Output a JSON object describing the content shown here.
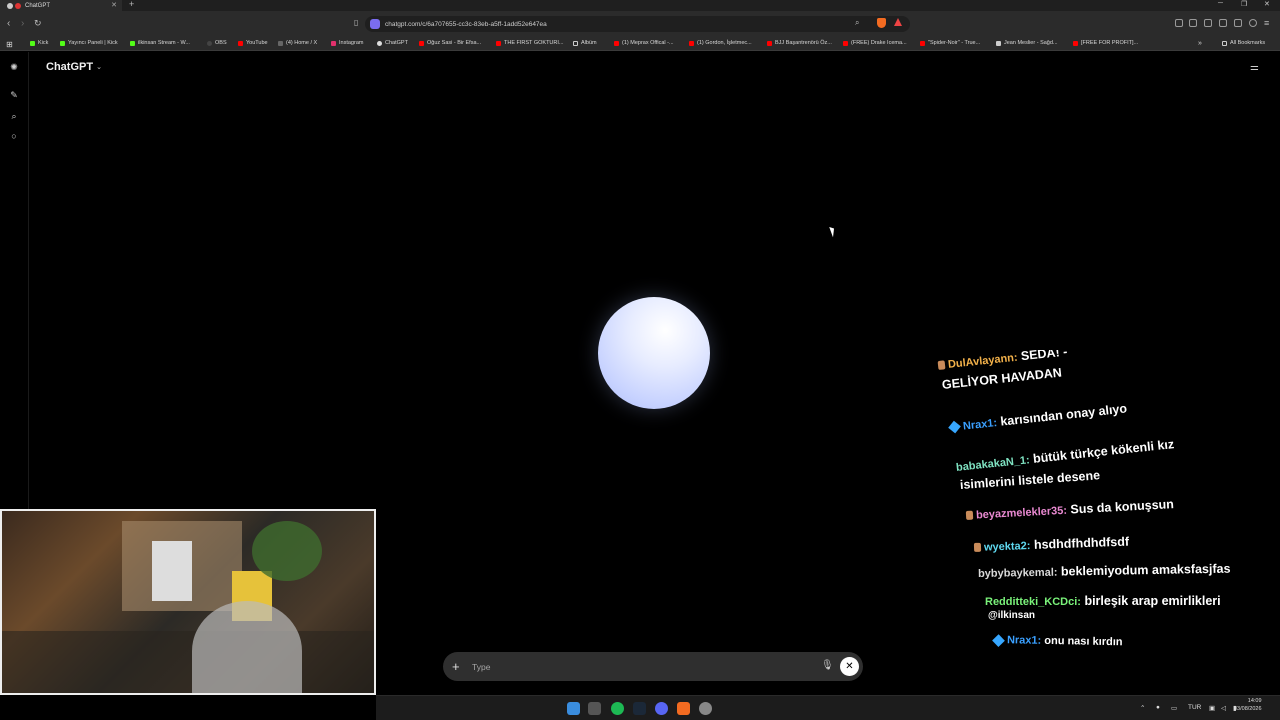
{
  "browser": {
    "tab_title": "ChatGPT",
    "url": "chatgpt.com/c/6a707655-cc3c-83eb-a5ff-1add52e647ea",
    "bookmarks": [
      {
        "label": "Kick",
        "color": "#53fc18"
      },
      {
        "label": "Yayıncı Paneli | Kick",
        "color": "#53fc18"
      },
      {
        "label": "ilkinsan Stream - W...",
        "color": "#53fc18"
      },
      {
        "label": "OBS",
        "color": "#333333"
      },
      {
        "label": "YouTube",
        "color": "#ff0000"
      },
      {
        "label": "(4) Home / X",
        "color": "#111111"
      },
      {
        "label": "Instagram",
        "color": "#e1306c"
      },
      {
        "label": "ChatGPT",
        "color": "#dddddd"
      },
      {
        "label": "Oğuz Sasi - Bir Efsa...",
        "color": "#ff0000"
      },
      {
        "label": "THE FIRST GOKTURI...",
        "color": "#ff0000"
      },
      {
        "label": "Albüm",
        "color": "#cccccc"
      },
      {
        "label": "(1) Meprax Offical -...",
        "color": "#ff0000"
      },
      {
        "label": "(1) Gordon, İşletmec...",
        "color": "#ff0000"
      },
      {
        "label": "BJJ Başantrenörü Öz...",
        "color": "#ff0000"
      },
      {
        "label": "(FREE) Drake Icema...",
        "color": "#ff0000"
      },
      {
        "label": "\"Spider-Noir\" - True...",
        "color": "#ff0000"
      },
      {
        "label": "Jean Meslier - Sağd...",
        "color": "#cccccc"
      },
      {
        "label": "[FREE FOR PROFIT]...",
        "color": "#ff0000"
      }
    ],
    "all_bookmarks": "All Bookmarks"
  },
  "app": {
    "model_name": "ChatGPT",
    "composer_placeholder": "Type"
  },
  "chat_overlay": [
    {
      "user": "DulAvlayann:",
      "text": "SEDA! -",
      "user_color": "#f2b14a",
      "badge": "badge"
    },
    {
      "user": "",
      "text": "GELİYOR HAVADAN",
      "user_color": "#ffffff",
      "badge": ""
    },
    {
      "user": "Nrax1:",
      "text": "karısından onay alıyo",
      "user_color": "#3aa0ff",
      "badge": "gem"
    },
    {
      "user": "babakakaN_1:",
      "text": "bütük türkçe kökenli kız",
      "user_color": "#7fe3c2",
      "badge": ""
    },
    {
      "user": "",
      "text": "isimlerini listele desene",
      "user_color": "#ffffff",
      "badge": ""
    },
    {
      "user": "beyazmelekler35:",
      "text": "Sus da konuşsun",
      "user_color": "#e989d1",
      "badge": "badge"
    },
    {
      "user": "wyekta2:",
      "text": "hsdhdfhdhdfsdf",
      "user_color": "#5fd9f0",
      "badge": "badge"
    },
    {
      "user": "bybybaykemal:",
      "text": "beklemiyodum amaksfasjfas",
      "user_color": "#d9d9d9",
      "badge": ""
    },
    {
      "user": "Redditteki_KCDci:",
      "text": "birleşik arap emirlikleri",
      "user_color": "#7af27a",
      "badge": ""
    },
    {
      "user": "",
      "text": "@ilkinsan",
      "user_color": "#ffffff",
      "badge": ""
    },
    {
      "user": "Nrax1:",
      "text": "onu nası kırdın",
      "user_color": "#3aa0ff",
      "badge": "gem"
    }
  ],
  "taskbar": {
    "language": "TUR",
    "time": "14:09",
    "date": "03/08/2026"
  }
}
